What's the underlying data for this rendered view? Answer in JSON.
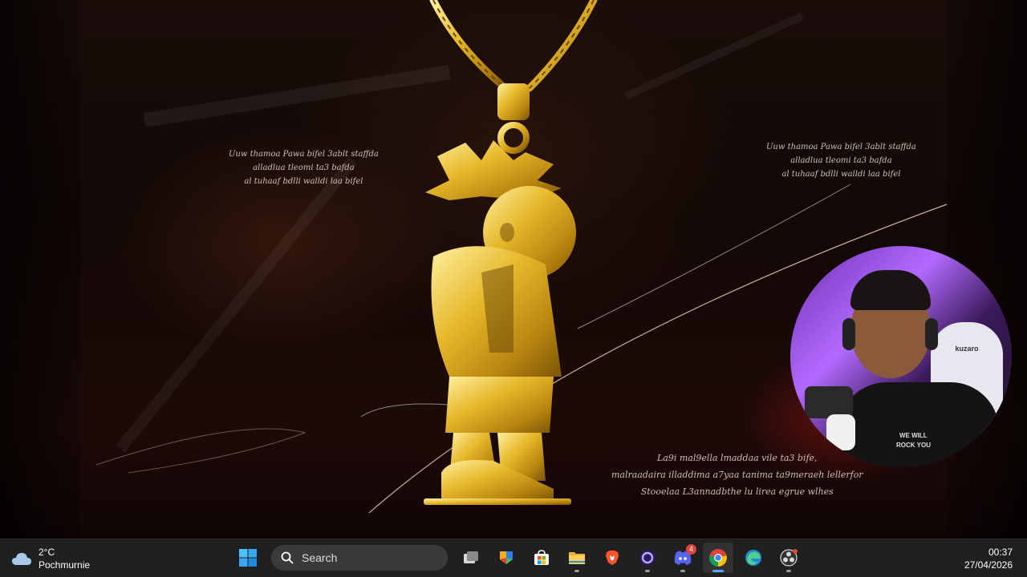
{
  "wallpaper": {
    "script_top_left": [
      "Uuw thamoa Pawa bifel 3ablt staffda",
      "alladlua tleomi ta3 bafda",
      "al tuhaaf bdlli walldi laa bifel"
    ],
    "script_top_right": [
      "Uuw thamoa Pawa bifel 3ablt staffda",
      "alladlua tleomi ta3 bafda",
      "al tuhaaf bdlli walldi laa bifel"
    ],
    "script_lower_right": [
      "La9i mal9ella lmaddaa vile ta3 bife,",
      "malraadaira illaddima a7yaa tanima ta9meraeh lellerfor",
      "Stooelaa L3annadbthe lu lirea egrue wlhes"
    ]
  },
  "webcam": {
    "chair_brand": "kuzaro",
    "shirt_text": [
      "WE WILL",
      "ROCK YOU"
    ]
  },
  "taskbar": {
    "weather": {
      "temp": "2°C",
      "condition": "Pochmurnie",
      "icon": "cloud-icon"
    },
    "search": {
      "label": "Search"
    },
    "apps": [
      {
        "name": "task-view",
        "icon": "task-view-icon",
        "running": false,
        "badge": ""
      },
      {
        "name": "widgets-store",
        "icon": "colorful-app-icon",
        "running": false,
        "badge": ""
      },
      {
        "name": "microsoft-store",
        "icon": "store-icon",
        "running": false,
        "badge": ""
      },
      {
        "name": "file-explorer",
        "icon": "folder-icon",
        "running": true,
        "badge": ""
      },
      {
        "name": "brave",
        "icon": "brave-lion-icon",
        "running": false,
        "badge": ""
      },
      {
        "name": "circle-app",
        "icon": "ring-app-icon",
        "running": true,
        "badge": ""
      },
      {
        "name": "discord",
        "icon": "discord-icon",
        "running": true,
        "badge": "4"
      },
      {
        "name": "chrome",
        "icon": "chrome-icon",
        "running": true,
        "badge": ""
      },
      {
        "name": "edge",
        "icon": "edge-icon",
        "running": false,
        "badge": ""
      },
      {
        "name": "obs",
        "icon": "obs-icon",
        "running": true,
        "badge": ""
      }
    ],
    "clock": {
      "time": "00:37",
      "date": "27/04/2026"
    }
  },
  "colors": {
    "taskbar_bg": "#202020",
    "accent": "#58a6ff",
    "gold": "#d9a820",
    "badge": "#e0443a"
  }
}
